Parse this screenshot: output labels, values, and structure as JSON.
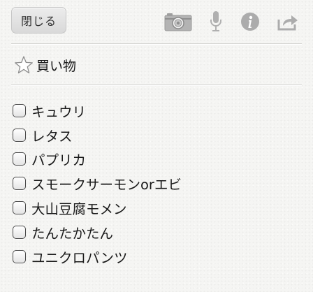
{
  "toolbar": {
    "close_label": "閉じる",
    "icons": [
      "camera-icon",
      "microphone-icon",
      "info-icon",
      "share-icon"
    ]
  },
  "note": {
    "title": "買い物",
    "starred": false
  },
  "checklist": {
    "items": [
      {
        "label": "キュウリ",
        "checked": false
      },
      {
        "label": "レタス",
        "checked": false
      },
      {
        "label": "パプリカ",
        "checked": false
      },
      {
        "label": "スモークサーモンorエビ",
        "checked": false
      },
      {
        "label": "大山豆腐モメン",
        "checked": false
      },
      {
        "label": "たんたかたん",
        "checked": false
      },
      {
        "label": "ユニクロパンツ",
        "checked": false
      }
    ]
  },
  "colors": {
    "background": "#f5f5f3",
    "icon_gray": "#a9a9a9",
    "text": "#1c1c1c"
  }
}
